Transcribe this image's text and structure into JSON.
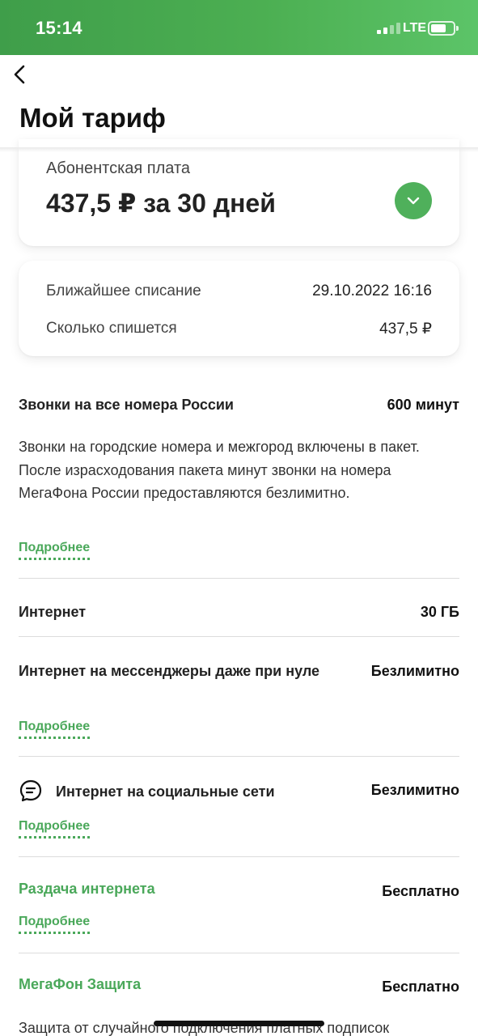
{
  "status_bar": {
    "time": "15:14",
    "network": "LTE"
  },
  "header": {
    "title": "Мой тариф",
    "back_icon": "chevron-left-icon"
  },
  "fee": {
    "label": "Абонентская плата",
    "value": "437,5 ₽ за 30 дней",
    "expand_icon": "chevron-down-icon"
  },
  "charge": {
    "next_label": "Ближайшее списание",
    "next_value": "29.10.2022 16:16",
    "amount_label": "Сколько спишется",
    "amount_value": "437,5 ₽"
  },
  "items": [
    {
      "title": "Звонки на все номера России",
      "value": "600 минут",
      "description": "Звонки на городские номера и межгород включены в пакет. После израсходования пакета минут звонки на номера МегаФона России предоставляются безлимитно.",
      "more": "Подробнее"
    },
    {
      "title": "Интернет",
      "value": "30 ГБ"
    },
    {
      "title": "Интернет на мессенджеры даже при нуле",
      "value": "Безлимитно",
      "more": "Подробнее"
    },
    {
      "title": "Интернет на социальные сети",
      "value": "Безлимитно",
      "more": "Подробнее",
      "icon": "chat-bubble-icon"
    },
    {
      "title": "Раздача интернета",
      "value": "Бесплатно",
      "more": "Подробнее"
    },
    {
      "title": "МегаФон Защита",
      "value": "Бесплатно",
      "description": "Защита от случайного подключения платных подписок"
    }
  ],
  "colors": {
    "accent": "#4aa85a",
    "status_bar": "#4caf52"
  }
}
